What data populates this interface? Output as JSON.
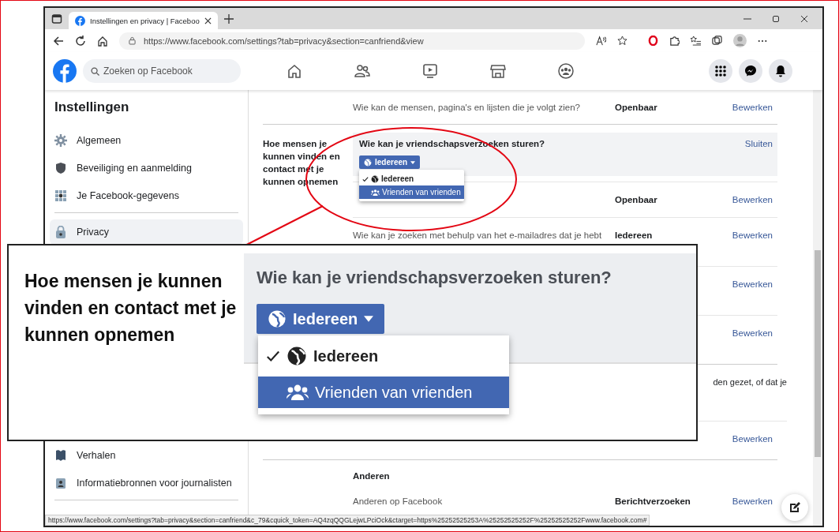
{
  "browser": {
    "tab_title": "Instellingen en privacy | Faceboo",
    "url": "https://www.facebook.com/settings?tab=privacy&section=canfriend&view",
    "status_url": "https://www.facebook.com/settings?tab=privacy&section=canfriend&c_79&cquick_token=AQ4zqQQGLejwLPciOck&ctarget=https%25252525253A%25252525252F%25252525252Fwww.facebook.com#"
  },
  "facebook": {
    "search_placeholder": "Zoeken op Facebook"
  },
  "sidebar": {
    "title": "Instellingen",
    "items": [
      {
        "label": "Algemeen",
        "selected": false
      },
      {
        "label": "Beveiliging en aanmelding",
        "selected": false
      },
      {
        "label": "Je Facebook-gegevens",
        "selected": false
      },
      {
        "label": "Privacy",
        "selected": true
      },
      {
        "label": "Verhalen",
        "selected": false
      },
      {
        "label": "Informatiebronnen voor journalisten",
        "selected": false
      }
    ]
  },
  "settings": [
    {
      "rows": [
        {
          "kind": "row",
          "question": "Wie kan de mensen, pagina's en lijsten die je volgt zien?",
          "value": "Openbaar",
          "action": "Bewerken"
        }
      ]
    },
    {
      "label": "Hoe mensen je kunnen vinden en contact met je kunnen opnemen",
      "rows": [
        {
          "kind": "expanded",
          "question": "Wie kan je vriendschapsverzoeken sturen?",
          "action": "Sluiten",
          "button": "Iedereen",
          "options": [
            {
              "label": "Iedereen",
              "checked": true,
              "selected": false
            },
            {
              "label": "Vrienden van vrienden",
              "checked": false,
              "selected": true
            }
          ]
        },
        {
          "kind": "row",
          "value": "Openbaar",
          "action": "Bewerken"
        },
        {
          "kind": "row",
          "question": "Wie kan je zoeken met behulp van het e-mailadres dat je hebt",
          "value": "Iedereen",
          "action": "Bewerken"
        },
        {
          "kind": "row",
          "action": "Bewerken"
        },
        {
          "kind": "row",
          "action": "Bewerken"
        }
      ]
    },
    {
      "rows": [
        {
          "kind": "note",
          "question": "den gezet, of dat je"
        },
        {
          "kind": "row",
          "action": "Bewerken"
        }
      ]
    },
    {
      "heading": "Anderen",
      "rows": [
        {
          "kind": "row",
          "question": "Anderen op Facebook",
          "value": "Berichtverzoeken",
          "action": "Bewerken"
        }
      ]
    }
  ],
  "inset": {
    "section_label": "Hoe mensen je kunnen vinden en contact met je kunnen opnemen",
    "question": "Wie kan je vriendschapsverzoeken sturen?",
    "button": "Iedereen",
    "options": [
      {
        "label": "Iedereen",
        "checked": true,
        "selected": false
      },
      {
        "label": "Vrienden van vrienden",
        "checked": false,
        "selected": true
      }
    ]
  }
}
